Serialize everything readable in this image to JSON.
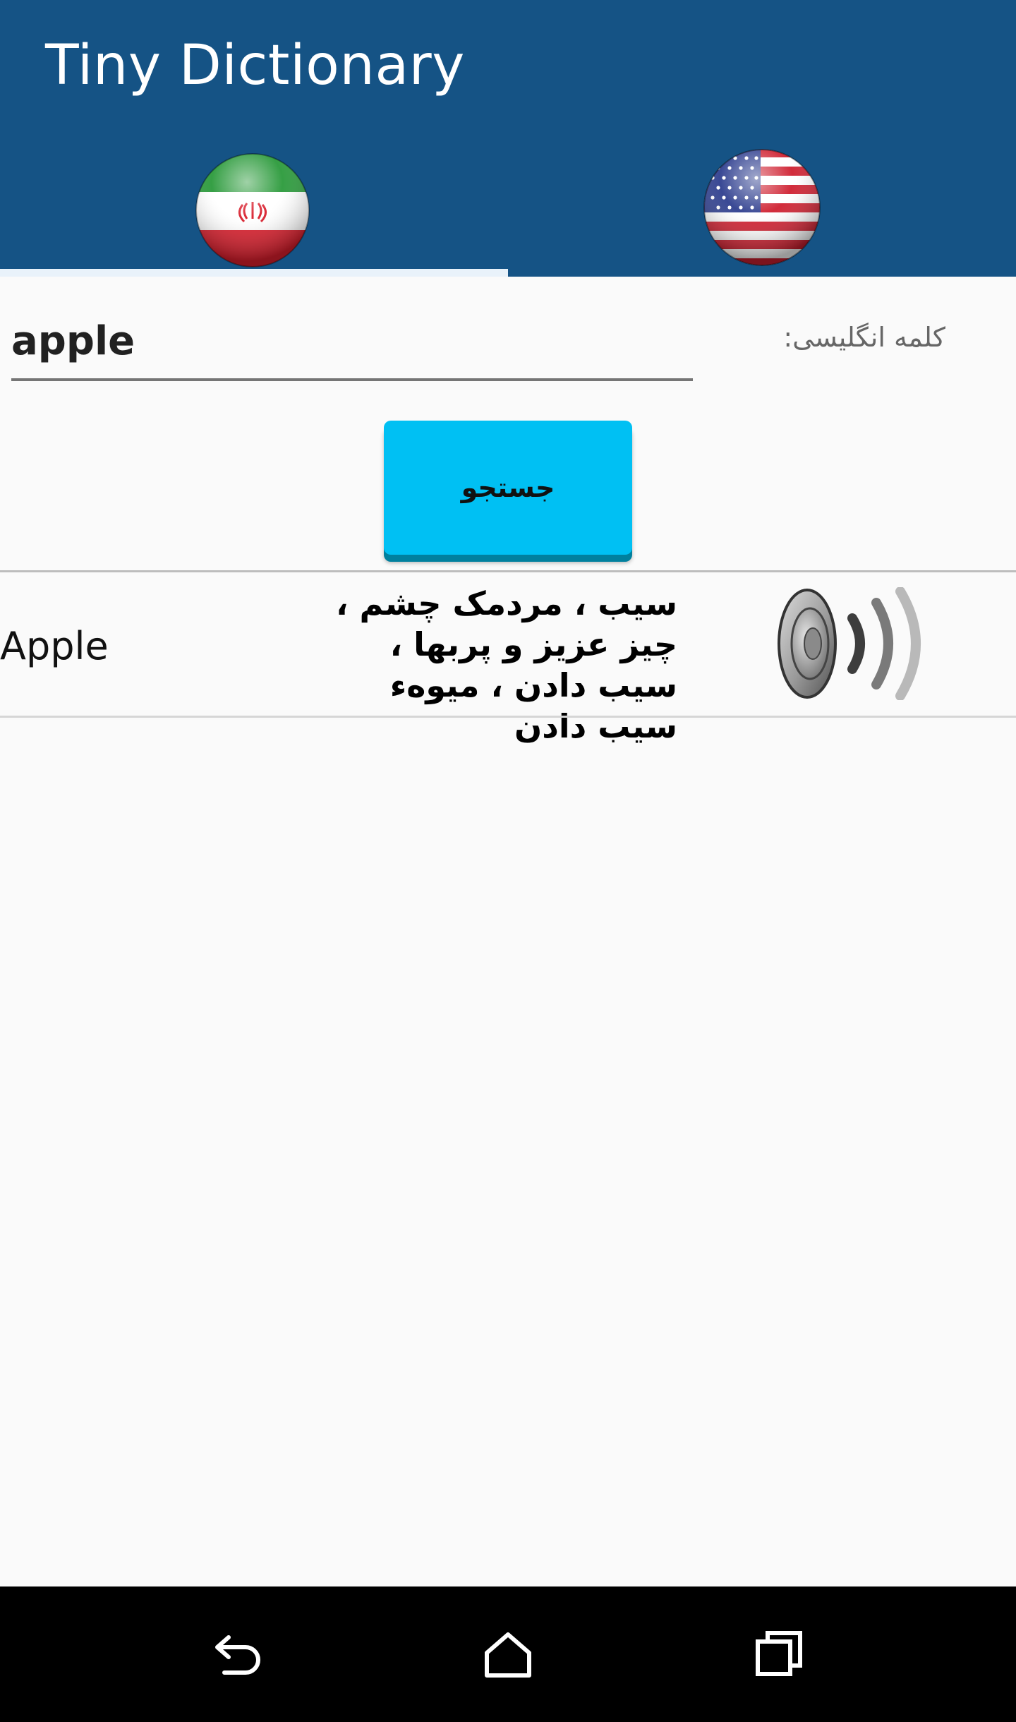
{
  "app": {
    "title": "Tiny Dictionary"
  },
  "tabs": [
    {
      "name": "Persian",
      "icon": "iran-flag-icon",
      "selected": true
    },
    {
      "name": "English",
      "icon": "usa-flag-icon",
      "selected": false
    }
  ],
  "search": {
    "value": "apple",
    "label": "کلمه انگلیسی:",
    "button_label": "جستجو"
  },
  "result": {
    "word": "Apple",
    "meaning": "سیب ، مردمک چشم ، چیز عزیز و پربها ، سیب دادن ، میوهء سیب دادن",
    "audio_icon": "speaker-icon"
  },
  "navbar": {
    "buttons": [
      "back-icon",
      "home-icon",
      "recents-icon"
    ]
  },
  "colors": {
    "appbar": "#155385",
    "button": "#00c0f3",
    "tab_indicator": "#e9f2fa"
  }
}
